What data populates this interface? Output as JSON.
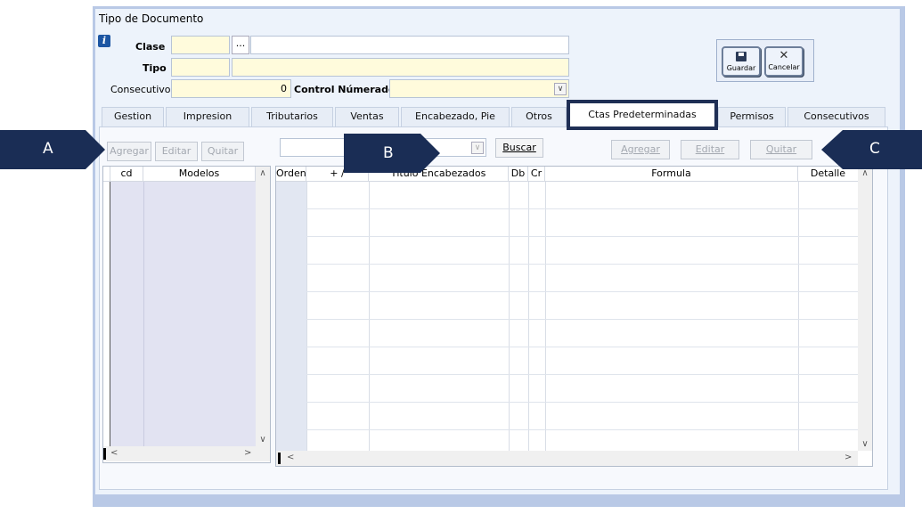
{
  "window": {
    "title": "Tipo de Documento"
  },
  "form": {
    "clase_label": "Clase",
    "clase_value": "",
    "clase_button": "...",
    "clase_desc": "",
    "tipo_label": "Tipo",
    "tipo_value": "",
    "tipo_desc": "",
    "consecutivo_label": "Consecutivo",
    "consecutivo_value": "0",
    "control_label": "Control Númerador :",
    "control_value": ""
  },
  "toolbar": {
    "save_label": "Guardar",
    "cancel_label": "Cancelar"
  },
  "tabs": [
    {
      "label": "Gestion"
    },
    {
      "label": "Impresion"
    },
    {
      "label": "Tributarios"
    },
    {
      "label": "Ventas"
    },
    {
      "label": "Encabezado, Pie"
    },
    {
      "label": "Otros"
    },
    {
      "label": "Ctas Predeterminadas"
    },
    {
      "label": "Permisos"
    },
    {
      "label": "Consecutivos"
    }
  ],
  "left_panel": {
    "buttons": {
      "add": "Agregar",
      "edit": "Editar",
      "remove": "Quitar"
    },
    "columns": {
      "cd": "cd",
      "modelos": "Modelos"
    }
  },
  "mid_toolbar": {
    "combo_value": "",
    "search_label": "Buscar"
  },
  "right_panel": {
    "buttons": {
      "add": "Agregar",
      "edit": "Editar",
      "remove": "Quitar"
    },
    "columns": {
      "orden": "Orden",
      "plusminus": "+ /",
      "titulo": "Título Encabezados",
      "db": "Db",
      "cr": "Cr",
      "formula": "Formula",
      "detalle": "Detalle"
    }
  },
  "markers": {
    "a": "A",
    "b": "B",
    "c": "C"
  },
  "colors": {
    "marker": "#1a2d55",
    "field_yellow": "#fffbdc",
    "highlight": "#1f2f55"
  }
}
